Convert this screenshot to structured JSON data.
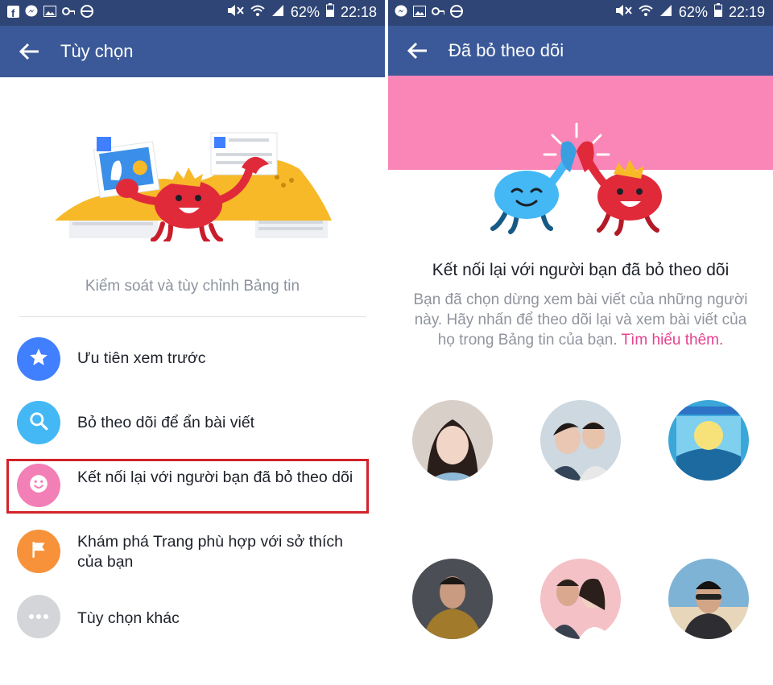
{
  "left_panel": {
    "status": {
      "battery": "62%",
      "time": "22:18"
    },
    "appbar": {
      "title": "Tùy chọn"
    },
    "caption": "Kiểm soát và tùy chỉnh Bảng tin",
    "items": [
      {
        "label": "Ưu tiên xem trước",
        "icon": "star-icon",
        "color": "#4080ff"
      },
      {
        "label": "Bỏ theo dõi để ẩn bài viết",
        "icon": "search-icon",
        "color": "#43b8f5"
      },
      {
        "label": "Kết nối lại với người bạn đã bỏ theo dõi",
        "icon": "smiley-icon",
        "color": "#f37fb7"
      },
      {
        "label": "Khám phá Trang phù hợp với sở thích của bạn",
        "icon": "flag-icon",
        "color": "#f7923b"
      },
      {
        "label": "Tùy chọn khác",
        "icon": "more-icon",
        "color": "#d3d5d9"
      }
    ],
    "highlight_color": "#d3232a"
  },
  "right_panel": {
    "status": {
      "battery": "62%",
      "time": "22:19"
    },
    "appbar": {
      "title": "Đã bỏ theo dõi"
    },
    "banner_color": "#f986b7",
    "headline": "Kết nối lại với người bạn đã bỏ theo dõi",
    "description": "Bạn đã chọn dừng xem bài viết của những người này. Hãy nhấn để theo dõi lại và xem bài viết của họ trong Bảng tin của bạn.",
    "learn_more": "Tìm hiểu thêm.",
    "avatars": [
      {
        "name": "friend-avatar-1"
      },
      {
        "name": "friend-avatar-2"
      },
      {
        "name": "friend-avatar-3"
      },
      {
        "name": "friend-avatar-4"
      },
      {
        "name": "friend-avatar-5"
      },
      {
        "name": "friend-avatar-6"
      }
    ]
  },
  "colors": {
    "statusbar": "#2f4575",
    "appbar": "#3b5998"
  }
}
